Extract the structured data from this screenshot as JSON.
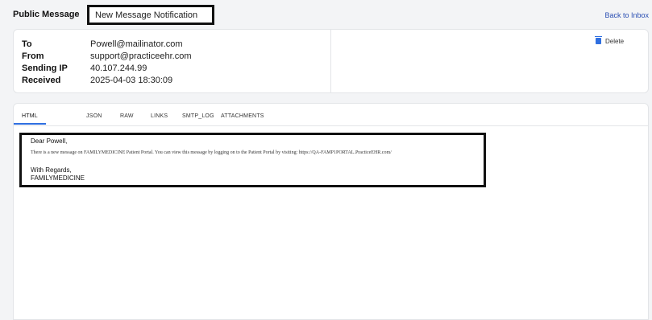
{
  "breadcrumb": {
    "root": "Public Message",
    "separator": "›",
    "subject": "New  Message Notification"
  },
  "back_link": "Back to Inbox",
  "header": {
    "fields": [
      {
        "label": "To",
        "value": "Powell@mailinator.com"
      },
      {
        "label": "From",
        "value": "support@practiceehr.com"
      },
      {
        "label": "Sending IP",
        "value": "40.107.244.99"
      },
      {
        "label": "Received",
        "value": "2025-04-03 18:30:09"
      }
    ],
    "delete_label": "Delete"
  },
  "tabs": [
    {
      "label": "HTML",
      "active": true
    },
    {
      "label": "JSON",
      "active": false
    },
    {
      "label": "RAW",
      "active": false
    },
    {
      "label": "LINKS",
      "active": false
    },
    {
      "label": "SMTP_LOG",
      "active": false
    },
    {
      "label": "ATTACHMENTS",
      "active": false
    }
  ],
  "message": {
    "greeting": "Dear Powell,",
    "body": "There is a  new message on FAMILYMEDICINE Patient Portal. You can view this message by logging on to the Patient Portal by visiting: https://QA-FAMP1PORTAL.PracticeEHR.com/",
    "regards": "With Regards,",
    "signature": "FAMILYMEDICINE"
  },
  "colors": {
    "accent": "#2f6fe0",
    "link": "#2b4fb3",
    "background": "#f3f4f6"
  }
}
